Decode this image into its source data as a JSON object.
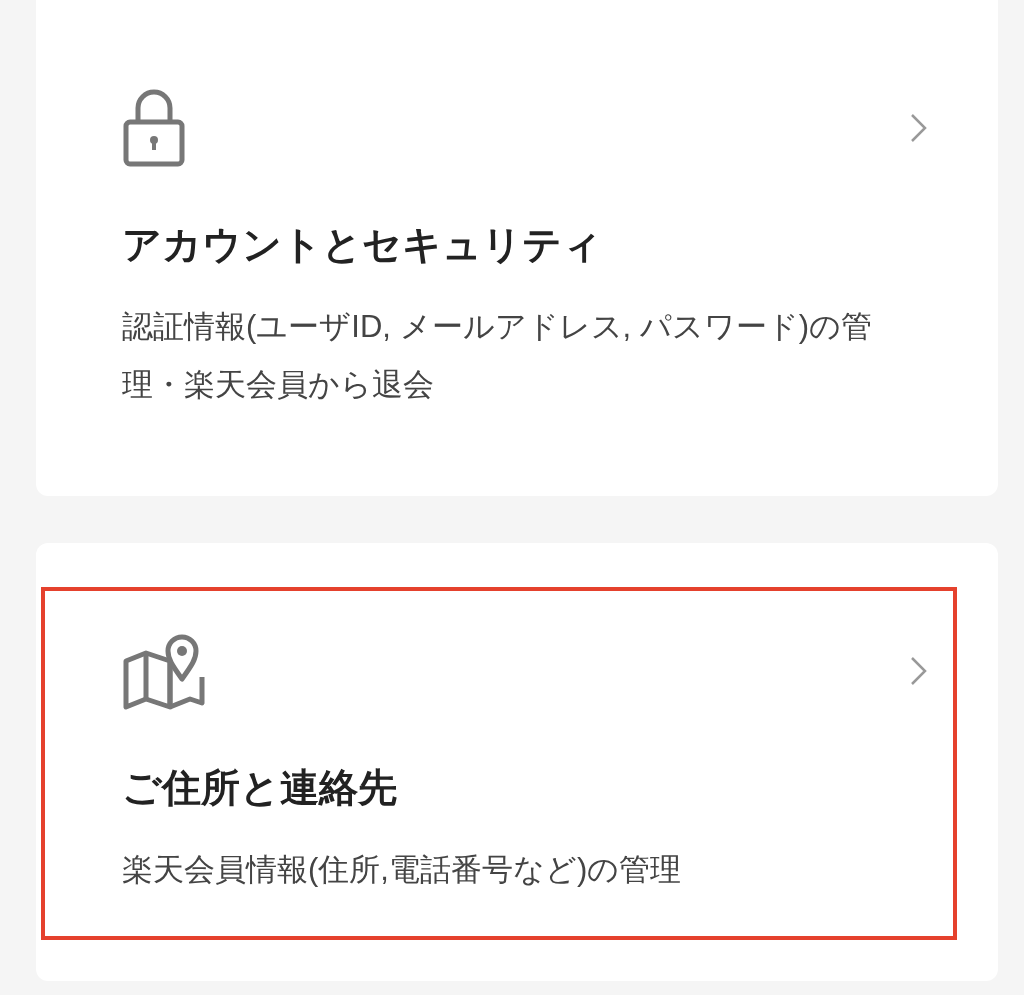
{
  "cards": [
    {
      "kind": "lock",
      "title": "アカウントとセキュリティ",
      "description": "認証情報(ユーザID, メールアドレス, パスワード)の管理・楽天会員から退会",
      "highlighted": false
    },
    {
      "kind": "map",
      "title": "ご住所と連絡先",
      "description": "楽天会員情報(住所,電話番号など)の管理",
      "highlighted": true
    }
  ]
}
